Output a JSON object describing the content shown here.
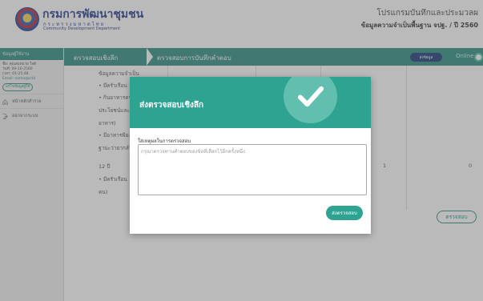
{
  "header": {
    "brand_th": "กรมการพัฒนาชุมชน",
    "brand_spaced": "กระทรวงมหาดไทย",
    "brand_en": "Community Development Department",
    "program_title": "โปรแกรมบันทึกและประมวลผ",
    "program_sub": "ข้อมูลความจำเป็นพื้นฐาน จปฐ. / ปี 2560"
  },
  "sidebar": {
    "head": "ข้อมูลผู้ใช้งาน",
    "user_name": "ชื่อ: คุณสมหมาย ใจดี",
    "login": "วันที่: 09-10-2560",
    "time": "เวลา: 01:25:48",
    "email": "Email: name@cdd",
    "edit_label": "แก้ไขข้อมูลผู้ใช้",
    "items": [
      {
        "label": "หน้าหลักสำรวจ"
      },
      {
        "label": "ออกจากระบบ"
      }
    ]
  },
  "nav": {
    "crumb1": "ตรวจสอบเชิงลึก",
    "crumb2": "ตรวจสอบการบันทึกคำตอบ",
    "badge": "ส่งข้อมูล",
    "status": "Online"
  },
  "content": {
    "rows": [
      "ข้อมูลความจำเป็น",
      "• มีครัวเรือน",
      "• กินอาหารครบ",
      "ประโยชน์และปลอดภัย",
      "อาหาร)",
      "• มีอาหารพียง",
      "ฐานะว่ายากลำบาก",
      "12 ปี",
      "• มีครัวเรือน",
      "คน)"
    ],
    "val1": "1",
    "val2": "0",
    "audit_button": "ตรวจสอบ"
  },
  "modal": {
    "title": "ส่งตรวจสอบเชิงลึก",
    "field_label": "ใส่เหตุผลในการตรวจสอบ",
    "placeholder": "กรุณาตรวจทานคำตอบของข้อที่เลือกไว้อีกครั้งหนึ่ง",
    "submit": "ส่งตรวจสอบ"
  },
  "colors": {
    "teal": "#2ea391",
    "navy": "#273e8a"
  }
}
